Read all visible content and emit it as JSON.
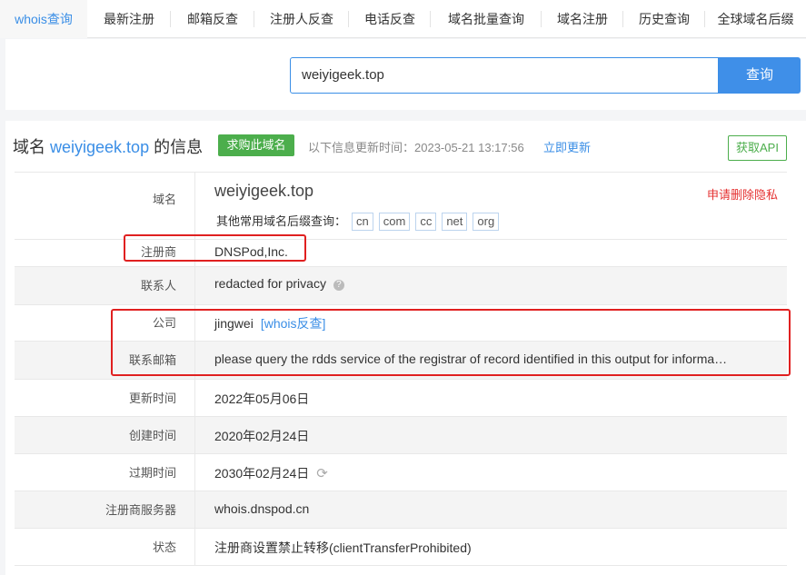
{
  "tabs": [
    "whois查询",
    "最新注册",
    "邮箱反查",
    "注册人反查",
    "电话反查",
    "域名批量查询",
    "域名注册",
    "历史查询",
    "全球域名后缀"
  ],
  "search": {
    "value": "weiyigeek.top",
    "button": "查询"
  },
  "header": {
    "prefix": "域名 ",
    "domain": "weiyigeek.top",
    "suffix": " 的信息",
    "buy_button": "求购此域名",
    "updated_text": "以下信息更新时间：2023-05-21 13:17:56",
    "update_now": "立即更新",
    "api_button": "获取API"
  },
  "domain_row": {
    "label": "域名",
    "value": "weiyigeek.top",
    "privacy_link": "申请删除隐私",
    "suffix_label": "其他常用域名后缀查询：",
    "suffixes": [
      "cn",
      "com",
      "cc",
      "net",
      "org"
    ]
  },
  "rows": {
    "registrar": {
      "label": "注册商",
      "value": "DNSPod,Inc."
    },
    "contact": {
      "label": "联系人",
      "value": "redacted for privacy",
      "help_icon": "question-icon"
    },
    "company": {
      "label": "公司",
      "value": "jingwei",
      "link": "[whois反查]"
    },
    "email": {
      "label": "联系邮箱",
      "value": "please query the rdds service of the registrar of record identified in this output for informa…"
    },
    "updated": {
      "label": "更新时间",
      "value": "2022年05月06日"
    },
    "created": {
      "label": "创建时间",
      "value": "2020年02月24日"
    },
    "expires": {
      "label": "过期时间",
      "value": "2030年02月24日",
      "icon": "refresh-icon"
    },
    "server": {
      "label": "注册商服务器",
      "value": "whois.dnspod.cn"
    },
    "status": {
      "label": "状态",
      "value": "注册商设置禁止转移(clientTransferProhibited)"
    }
  },
  "colors": {
    "accent": "#3a8ee6",
    "green": "#4cae4c",
    "highlight": "#e02020"
  }
}
